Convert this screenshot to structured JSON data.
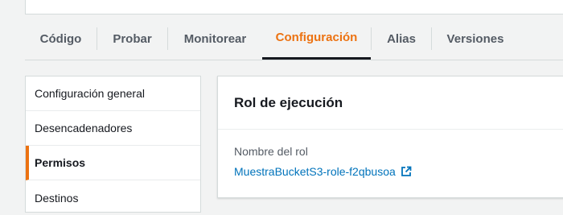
{
  "tabs": [
    {
      "label": "Código"
    },
    {
      "label": "Probar"
    },
    {
      "label": "Monitorear"
    },
    {
      "label": "Configuración",
      "active": true
    },
    {
      "label": "Alias"
    },
    {
      "label": "Versiones"
    }
  ],
  "sidenav": {
    "items": [
      {
        "label": "Configuración general"
      },
      {
        "label": "Desencadenadores"
      },
      {
        "label": "Permisos",
        "active": true
      },
      {
        "label": "Destinos"
      }
    ]
  },
  "card": {
    "title": "Rol de ejecución",
    "role_label": "Nombre del rol",
    "role_name": "MuestraBucketS3-role-f2qbusoa",
    "link_icon": "external-link-icon"
  },
  "colors": {
    "accent": "#ec7211",
    "link": "#0073bb",
    "active_underline": "#16191f"
  }
}
